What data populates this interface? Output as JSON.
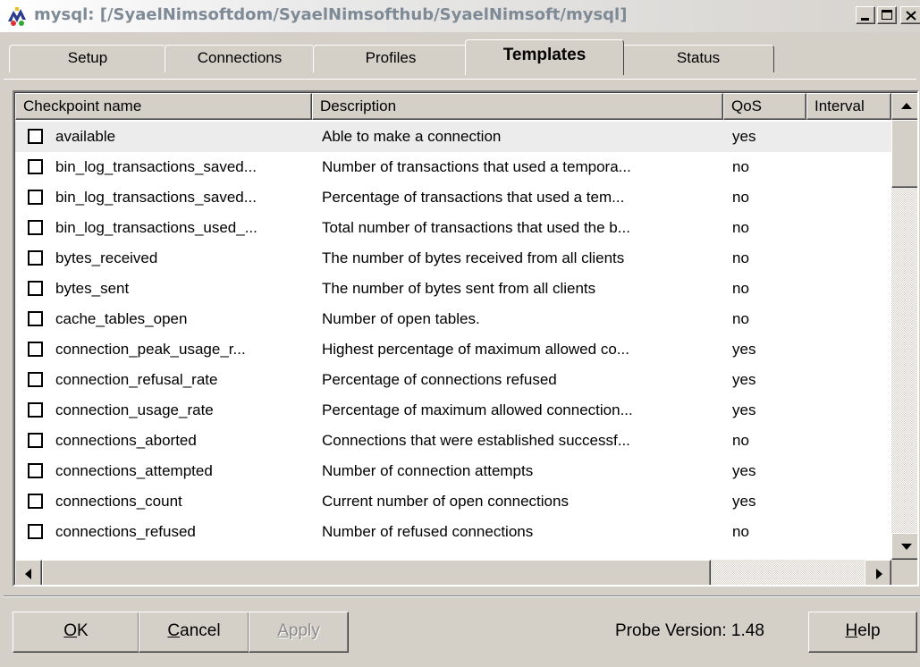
{
  "window": {
    "title": "mysql: [/SyaelNimsoftdom/SyaelNimsofthub/SyaelNimsoft/mysql]"
  },
  "tabs": [
    {
      "label": "Setup"
    },
    {
      "label": "Connections"
    },
    {
      "label": "Profiles"
    },
    {
      "label": "Templates",
      "active": true
    },
    {
      "label": "Status"
    }
  ],
  "table": {
    "columns": [
      "Checkpoint name",
      "Description",
      "QoS",
      "Interval"
    ],
    "rows": [
      {
        "name": "available",
        "description": "Able to make a connection",
        "qos": "yes",
        "checked": false,
        "selected": true
      },
      {
        "name": "bin_log_transactions_saved...",
        "description": "Number of transactions that used a tempora...",
        "qos": "no",
        "checked": false
      },
      {
        "name": "bin_log_transactions_saved...",
        "description": "Percentage of transactions that used a tem...",
        "qos": "no",
        "checked": false
      },
      {
        "name": "bin_log_transactions_used_...",
        "description": "Total number of transactions that used the b...",
        "qos": "no",
        "checked": false
      },
      {
        "name": "bytes_received",
        "description": "The number of bytes received from all clients",
        "qos": "no",
        "checked": false
      },
      {
        "name": "bytes_sent",
        "description": "The number of bytes sent from all clients",
        "qos": "no",
        "checked": false
      },
      {
        "name": "cache_tables_open",
        "description": "Number of open tables.",
        "qos": "no",
        "checked": false
      },
      {
        "name": "connection_peak_usage_r...",
        "description": "Highest percentage of maximum allowed co...",
        "qos": "yes",
        "checked": false
      },
      {
        "name": "connection_refusal_rate",
        "description": "Percentage of connections refused",
        "qos": "yes",
        "checked": false
      },
      {
        "name": "connection_usage_rate",
        "description": "Percentage of maximum allowed connection...",
        "qos": "yes",
        "checked": false
      },
      {
        "name": "connections_aborted",
        "description": "Connections that were established successf...",
        "qos": "no",
        "checked": false
      },
      {
        "name": "connections_attempted",
        "description": "Number of connection attempts",
        "qos": "yes",
        "checked": false
      },
      {
        "name": "connections_count",
        "description": "Current number of open connections",
        "qos": "yes",
        "checked": false
      },
      {
        "name": "connections_refused",
        "description": "Number of refused connections",
        "qos": "no",
        "checked": false
      }
    ]
  },
  "buttons": {
    "ok": {
      "pre": "",
      "accel": "O",
      "post": "K"
    },
    "cancel": {
      "pre": "",
      "accel": "C",
      "post": "ancel"
    },
    "apply": {
      "pre": "",
      "accel": "A",
      "post": "pply"
    },
    "help": {
      "pre": "",
      "accel": "H",
      "post": "elp"
    }
  },
  "probe_version": "Probe Version: 1.48",
  "icons": {
    "app": "nimsoft-probe-icon",
    "minimize": "minimize-icon",
    "maximize": "maximize-icon",
    "close": "close-icon"
  }
}
